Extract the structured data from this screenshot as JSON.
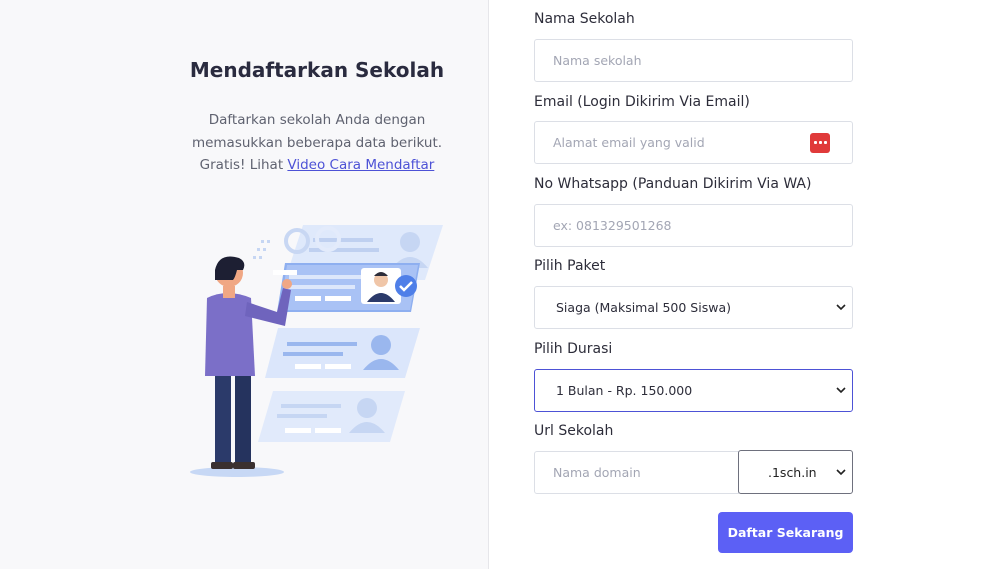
{
  "intro": {
    "title": "Mendaftarkan Sekolah",
    "line1": "Daftarkan sekolah Anda dengan",
    "line2": "memasukkan beberapa data berikut.",
    "line3_prefix": "Gratis! Lihat ",
    "video_link": "Video Cara Mendaftar"
  },
  "form": {
    "school_name": {
      "label": "Nama Sekolah",
      "placeholder": "Nama sekolah",
      "value": ""
    },
    "email": {
      "label": "Email (Login Dikirim Via Email)",
      "placeholder": "Alamat email yang valid",
      "value": "",
      "icon": "password-manager-icon",
      "icon_color": "#e03a3a"
    },
    "whatsapp": {
      "label": "No Whatsapp (Panduan Dikirim Via WA)",
      "placeholder": "ex: 081329501268",
      "value": ""
    },
    "package": {
      "label": "Pilih Paket",
      "selected": "Siaga (Maksimal 500 Siswa)"
    },
    "duration": {
      "label": "Pilih Durasi",
      "selected": "1 Bulan - Rp. 150.000"
    },
    "url": {
      "label": "Url Sekolah",
      "placeholder": "Nama domain",
      "value": "",
      "suffix": ".1sch.in"
    },
    "submit_label": "Daftar Sekarang"
  },
  "colors": {
    "accent": "#5c60f5",
    "link": "#4d52d6",
    "left_background": "#f8f8fa"
  }
}
